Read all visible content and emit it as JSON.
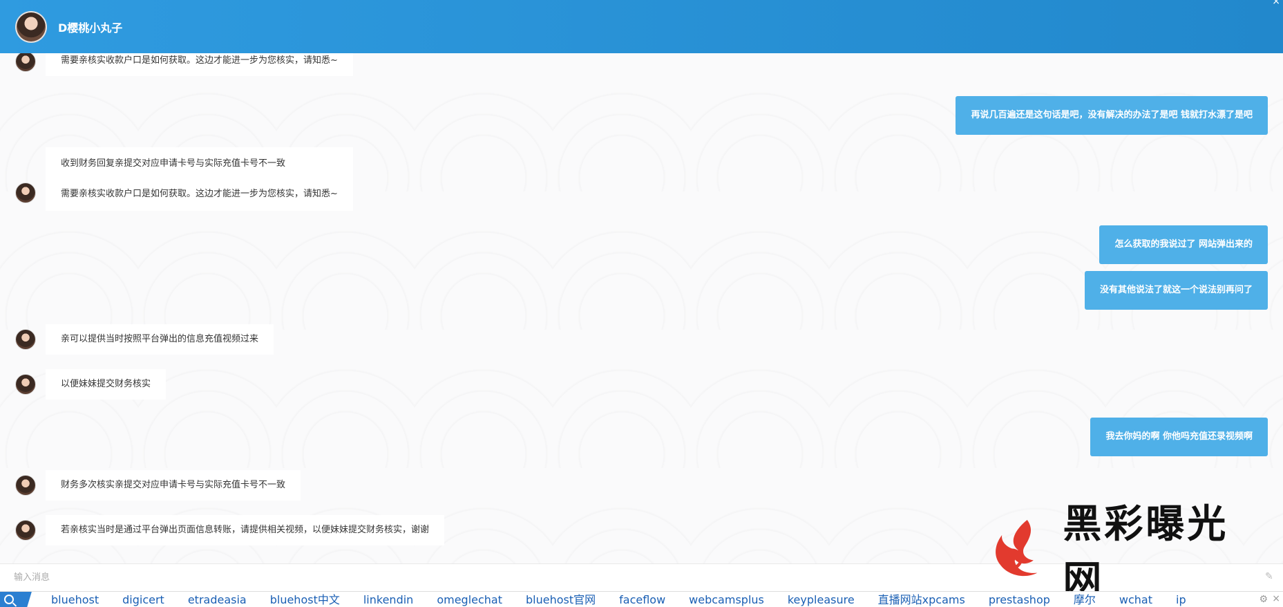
{
  "header": {
    "title": "D樱桃小丸子",
    "close_label": "×"
  },
  "messages": [
    {
      "dir": "in",
      "lines": [
        "需要亲核实收款户口是如何获取。这边才能进一步为您核实，请知悉~"
      ]
    },
    {
      "dir": "out",
      "text": "再说几百遍还是这句话是吧，没有解决的办法了是吧 钱就打水漂了是吧"
    },
    {
      "dir": "in",
      "lines": [
        "收到财务回复亲提交对应申请卡号与实际充值卡号不一致",
        "需要亲核实收款户口是如何获取。这边才能进一步为您核实，请知悉~"
      ]
    },
    {
      "dir": "out",
      "text": "怎么获取的我说过了 网站弹出来的"
    },
    {
      "dir": "out",
      "text": "没有其他说法了就这一个说法别再问了"
    },
    {
      "dir": "in",
      "lines": [
        "亲可以提供当时按照平台弹出的信息充值视频过来"
      ]
    },
    {
      "dir": "in",
      "lines": [
        "以便妹妹提交财务核实"
      ]
    },
    {
      "dir": "out",
      "text": "我去你妈的啊 你他吗充值还录视频啊"
    },
    {
      "dir": "in",
      "lines": [
        "财务多次核实亲提交对应申请卡号与实际充值卡号不一致"
      ]
    },
    {
      "dir": "in",
      "lines": [
        "若亲核实当时是通过平台弹出页面信息转账，请提供相关视频，以便妹妹提交财务核实，谢谢"
      ]
    }
  ],
  "input": {
    "placeholder": "输入消息"
  },
  "watermark": {
    "text": "黑彩曝光网"
  },
  "linkbar": {
    "links": [
      "bluehost",
      "digicert",
      "etradeasia",
      "bluehost中文",
      "linkendin",
      "omeglechat",
      "bluehost官网",
      "faceflow",
      "webcamsplus",
      "keypleasure",
      "直播网站xpcams",
      "prestashop",
      "摩尔",
      "wchat",
      "ip"
    ],
    "close_label": "×"
  },
  "colors": {
    "header": "#2288cc",
    "outgoing_bubble": "#4fb0e8",
    "link": "#1a5fb4",
    "watermark_red": "#e23a2e"
  }
}
